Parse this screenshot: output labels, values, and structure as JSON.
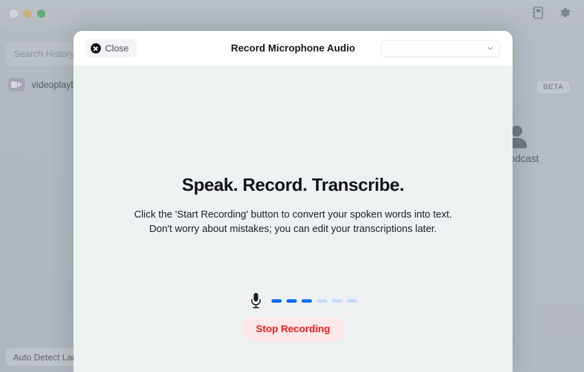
{
  "window": {
    "traffic_lights": [
      "close",
      "minimize",
      "maximize"
    ],
    "toolbar_icons": [
      "notebook-icon",
      "gear-icon"
    ]
  },
  "sidebar": {
    "search_placeholder": "Search History",
    "history_items": [
      {
        "icon": "video-camera-icon",
        "label": "videoplayback"
      }
    ],
    "language_button": "Auto Detect Lang"
  },
  "background_main": {
    "beta_badge": "BETA",
    "podcast_card": {
      "icon": "person-icon",
      "label": "e Podcast"
    }
  },
  "modal": {
    "close_button": "Close",
    "close_icon": "close-circle-icon",
    "title": "Record Microphone Audio",
    "device_select": {
      "value": "",
      "icon": "chevron-down-icon"
    },
    "hero": {
      "heading": "Speak. Record. Transcribe.",
      "line1": "Click the 'Start Recording' button to convert your spoken words into text.",
      "line2": "Don't worry about mistakes; you can edit your transcriptions later."
    },
    "recorder": {
      "mic_icon": "microphone-icon",
      "level_bars": [
        true,
        true,
        true,
        false,
        false,
        false
      ],
      "stop_button": "Stop Recording"
    }
  },
  "colors": {
    "accent_blue": "#0b6bf3",
    "accent_blue_muted": "#c8dcfa",
    "danger_red": "#f21d1d",
    "danger_bg": "#fce8e8",
    "modal_body_bg": "#eef1f2",
    "window_bg": "#bcc7d0"
  }
}
